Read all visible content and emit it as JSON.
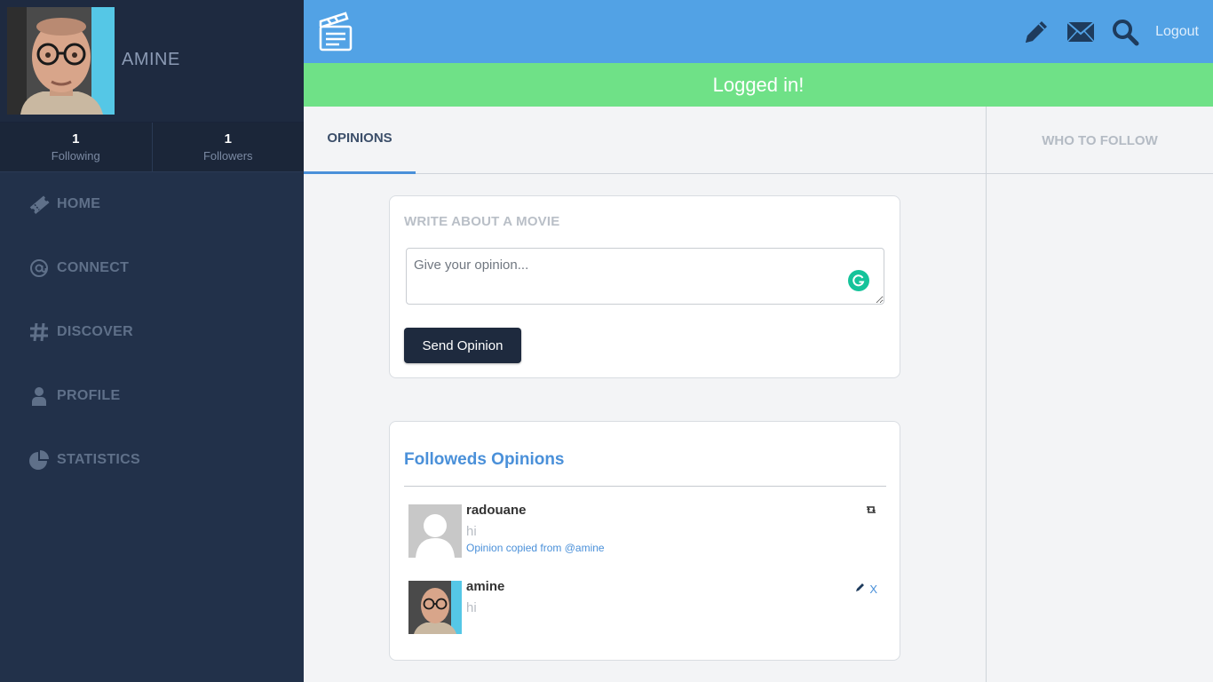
{
  "sidebar": {
    "username": "AMINE",
    "stats": [
      {
        "count": "1",
        "label": "Following"
      },
      {
        "count": "1",
        "label": "Followers"
      }
    ],
    "nav": [
      {
        "label": "HOME",
        "icon": "ticket-icon"
      },
      {
        "label": "CONNECT",
        "icon": "at-icon"
      },
      {
        "label": "DISCOVER",
        "icon": "hash-icon"
      },
      {
        "label": "PROFILE",
        "icon": "user-icon"
      },
      {
        "label": "STATISTICS",
        "icon": "pie-chart-icon"
      }
    ]
  },
  "topbar": {
    "logo_icon": "clapperboard-icon",
    "icons": [
      "pencil-icon",
      "envelope-icon",
      "search-icon"
    ],
    "logout_label": "Logout"
  },
  "banner": {
    "text": "Logged in!"
  },
  "tabs": {
    "opinions": "OPINIONS",
    "who_to_follow": "WHO TO FOLLOW"
  },
  "compose": {
    "title": "WRITE ABOUT A MOVIE",
    "placeholder": "Give your opinion...",
    "send_label": "Send Opinion"
  },
  "feed": {
    "title": "Followeds Opinions",
    "posts": [
      {
        "author": "radouane",
        "text": "hi",
        "note": "Opinion copied from @amine",
        "action_icon": "repost-icon"
      },
      {
        "author": "amine",
        "text": "hi",
        "action_icon": "edit-icon",
        "delete_label": "X"
      }
    ]
  },
  "colors": {
    "sidebar": "#22314a",
    "topbar": "#52a2e5",
    "banner": "#6fe187",
    "accent": "#4a90d9",
    "button": "#1e2a3e"
  }
}
